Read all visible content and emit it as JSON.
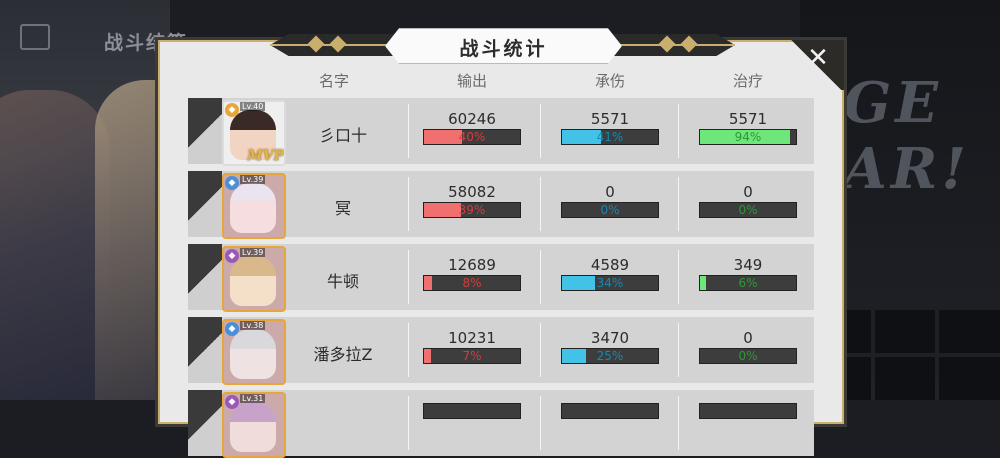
{
  "screen": {
    "bg_title": "战斗结算"
  },
  "panel": {
    "title": "战斗统计",
    "close_icon": "close-icon",
    "headers": {
      "name": "名字",
      "output": "输出",
      "damage_taken": "承伤",
      "healing": "治疗"
    }
  },
  "rows": [
    {
      "lv": "Lv.40",
      "name": "彡口十",
      "mvp": "MVP",
      "output": "60246",
      "output_pct": "40%",
      "output_frac": 0.4,
      "taken": "5571",
      "taken_pct": "41%",
      "taken_frac": 0.41,
      "heal": "5571",
      "heal_pct": "94%",
      "heal_frac": 0.94
    },
    {
      "lv": "Lv.39",
      "name": "冥",
      "output": "58082",
      "output_pct": "39%",
      "output_frac": 0.39,
      "taken": "0",
      "taken_pct": "0%",
      "taken_frac": 0.0,
      "heal": "0",
      "heal_pct": "0%",
      "heal_frac": 0.0
    },
    {
      "lv": "Lv.39",
      "name": "牛顿",
      "output": "12689",
      "output_pct": "8%",
      "output_frac": 0.08,
      "taken": "4589",
      "taken_pct": "34%",
      "taken_frac": 0.34,
      "heal": "349",
      "heal_pct": "6%",
      "heal_frac": 0.06
    },
    {
      "lv": "Lv.38",
      "name": "潘多拉Z",
      "output": "10231",
      "output_pct": "7%",
      "output_frac": 0.07,
      "taken": "3470",
      "taken_pct": "25%",
      "taken_frac": 0.25,
      "heal": "0",
      "heal_pct": "0%",
      "heal_frac": 0.0
    },
    {
      "lv": "Lv.31",
      "name": "",
      "output": "",
      "output_pct": "",
      "output_frac": 0,
      "taken": "",
      "taken_pct": "",
      "taken_frac": 0,
      "heal": "",
      "heal_pct": "",
      "heal_frac": 0
    }
  ],
  "colors": {
    "output": "#f07070",
    "taken": "#43c2e8",
    "heal": "#6ee67a",
    "frame_gold": "#c9ae6d"
  }
}
